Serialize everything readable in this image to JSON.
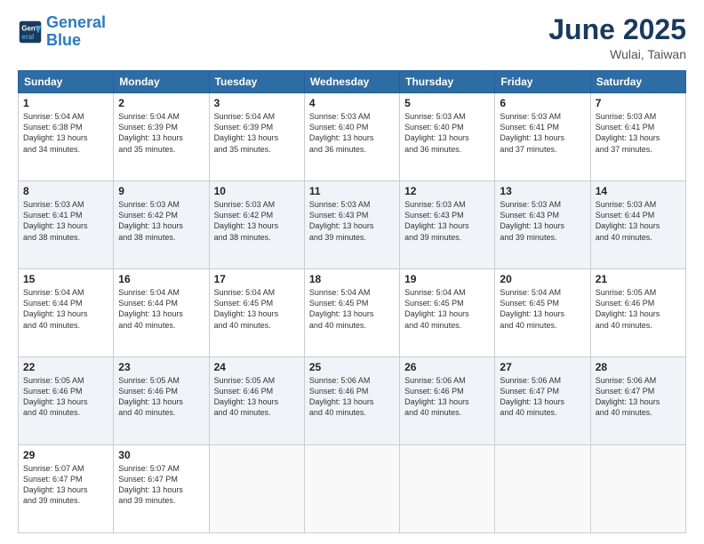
{
  "logo": {
    "line1": "General",
    "line2": "Blue"
  },
  "title": "June 2025",
  "location": "Wulai, Taiwan",
  "weekdays": [
    "Sunday",
    "Monday",
    "Tuesday",
    "Wednesday",
    "Thursday",
    "Friday",
    "Saturday"
  ],
  "weeks": [
    [
      {
        "day": "1",
        "text": "Sunrise: 5:04 AM\nSunset: 6:38 PM\nDaylight: 13 hours\nand 34 minutes."
      },
      {
        "day": "2",
        "text": "Sunrise: 5:04 AM\nSunset: 6:39 PM\nDaylight: 13 hours\nand 35 minutes."
      },
      {
        "day": "3",
        "text": "Sunrise: 5:04 AM\nSunset: 6:39 PM\nDaylight: 13 hours\nand 35 minutes."
      },
      {
        "day": "4",
        "text": "Sunrise: 5:03 AM\nSunset: 6:40 PM\nDaylight: 13 hours\nand 36 minutes."
      },
      {
        "day": "5",
        "text": "Sunrise: 5:03 AM\nSunset: 6:40 PM\nDaylight: 13 hours\nand 36 minutes."
      },
      {
        "day": "6",
        "text": "Sunrise: 5:03 AM\nSunset: 6:41 PM\nDaylight: 13 hours\nand 37 minutes."
      },
      {
        "day": "7",
        "text": "Sunrise: 5:03 AM\nSunset: 6:41 PM\nDaylight: 13 hours\nand 37 minutes."
      }
    ],
    [
      {
        "day": "8",
        "text": "Sunrise: 5:03 AM\nSunset: 6:41 PM\nDaylight: 13 hours\nand 38 minutes."
      },
      {
        "day": "9",
        "text": "Sunrise: 5:03 AM\nSunset: 6:42 PM\nDaylight: 13 hours\nand 38 minutes."
      },
      {
        "day": "10",
        "text": "Sunrise: 5:03 AM\nSunset: 6:42 PM\nDaylight: 13 hours\nand 38 minutes."
      },
      {
        "day": "11",
        "text": "Sunrise: 5:03 AM\nSunset: 6:43 PM\nDaylight: 13 hours\nand 39 minutes."
      },
      {
        "day": "12",
        "text": "Sunrise: 5:03 AM\nSunset: 6:43 PM\nDaylight: 13 hours\nand 39 minutes."
      },
      {
        "day": "13",
        "text": "Sunrise: 5:03 AM\nSunset: 6:43 PM\nDaylight: 13 hours\nand 39 minutes."
      },
      {
        "day": "14",
        "text": "Sunrise: 5:03 AM\nSunset: 6:44 PM\nDaylight: 13 hours\nand 40 minutes."
      }
    ],
    [
      {
        "day": "15",
        "text": "Sunrise: 5:04 AM\nSunset: 6:44 PM\nDaylight: 13 hours\nand 40 minutes."
      },
      {
        "day": "16",
        "text": "Sunrise: 5:04 AM\nSunset: 6:44 PM\nDaylight: 13 hours\nand 40 minutes."
      },
      {
        "day": "17",
        "text": "Sunrise: 5:04 AM\nSunset: 6:45 PM\nDaylight: 13 hours\nand 40 minutes."
      },
      {
        "day": "18",
        "text": "Sunrise: 5:04 AM\nSunset: 6:45 PM\nDaylight: 13 hours\nand 40 minutes."
      },
      {
        "day": "19",
        "text": "Sunrise: 5:04 AM\nSunset: 6:45 PM\nDaylight: 13 hours\nand 40 minutes."
      },
      {
        "day": "20",
        "text": "Sunrise: 5:04 AM\nSunset: 6:45 PM\nDaylight: 13 hours\nand 40 minutes."
      },
      {
        "day": "21",
        "text": "Sunrise: 5:05 AM\nSunset: 6:46 PM\nDaylight: 13 hours\nand 40 minutes."
      }
    ],
    [
      {
        "day": "22",
        "text": "Sunrise: 5:05 AM\nSunset: 6:46 PM\nDaylight: 13 hours\nand 40 minutes."
      },
      {
        "day": "23",
        "text": "Sunrise: 5:05 AM\nSunset: 6:46 PM\nDaylight: 13 hours\nand 40 minutes."
      },
      {
        "day": "24",
        "text": "Sunrise: 5:05 AM\nSunset: 6:46 PM\nDaylight: 13 hours\nand 40 minutes."
      },
      {
        "day": "25",
        "text": "Sunrise: 5:06 AM\nSunset: 6:46 PM\nDaylight: 13 hours\nand 40 minutes."
      },
      {
        "day": "26",
        "text": "Sunrise: 5:06 AM\nSunset: 6:46 PM\nDaylight: 13 hours\nand 40 minutes."
      },
      {
        "day": "27",
        "text": "Sunrise: 5:06 AM\nSunset: 6:47 PM\nDaylight: 13 hours\nand 40 minutes."
      },
      {
        "day": "28",
        "text": "Sunrise: 5:06 AM\nSunset: 6:47 PM\nDaylight: 13 hours\nand 40 minutes."
      }
    ],
    [
      {
        "day": "29",
        "text": "Sunrise: 5:07 AM\nSunset: 6:47 PM\nDaylight: 13 hours\nand 39 minutes."
      },
      {
        "day": "30",
        "text": "Sunrise: 5:07 AM\nSunset: 6:47 PM\nDaylight: 13 hours\nand 39 minutes."
      },
      {
        "day": "",
        "text": ""
      },
      {
        "day": "",
        "text": ""
      },
      {
        "day": "",
        "text": ""
      },
      {
        "day": "",
        "text": ""
      },
      {
        "day": "",
        "text": ""
      }
    ]
  ]
}
